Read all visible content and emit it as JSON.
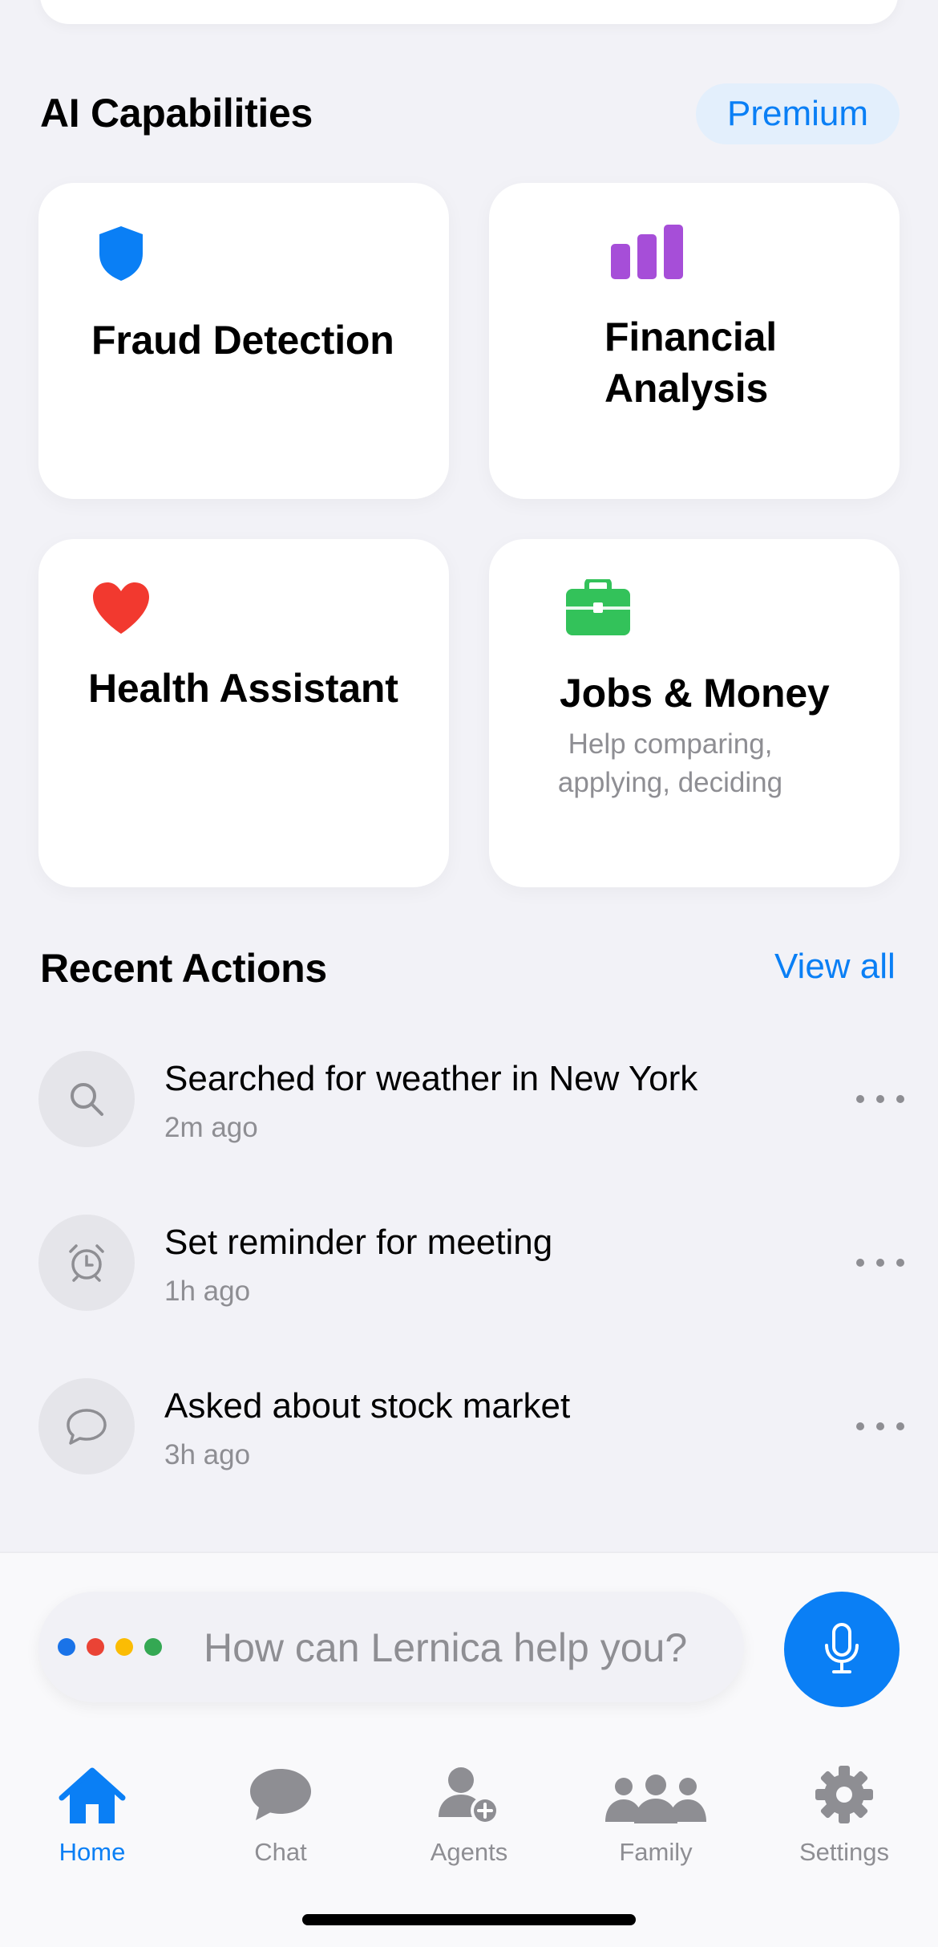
{
  "capabilities": {
    "heading": "AI Capabilities",
    "badge": "Premium",
    "cards": [
      {
        "title": "Fraud Detection",
        "icon": "shield-icon",
        "color": "#0a7ff5"
      },
      {
        "title_line1": "Financial",
        "title_line2": "Analysis",
        "icon": "bar-chart-icon",
        "color": "#a64ed8"
      },
      {
        "title": "Health Assistant",
        "icon": "heart-icon",
        "color": "#f2392f"
      },
      {
        "title": "Jobs & Money",
        "desc_line1": "Help comparing,",
        "desc_line2": "applying, deciding",
        "icon": "briefcase-icon",
        "color": "#33c25a"
      }
    ]
  },
  "recent": {
    "heading": "Recent Actions",
    "view_all": "View all",
    "items": [
      {
        "title": "Searched for weather in New York",
        "time": "2m ago",
        "icon": "search-icon"
      },
      {
        "title": "Set reminder for meeting",
        "time": "1h ago",
        "icon": "alarm-clock-icon"
      },
      {
        "title": "Asked about stock market",
        "time": "3h ago",
        "icon": "chat-bubble-icon"
      }
    ]
  },
  "assistant": {
    "placeholder": "How can Lernica help you?",
    "dot_colors": [
      "#1a73e8",
      "#ea4335",
      "#fbbc04",
      "#34a853"
    ]
  },
  "tabs": [
    {
      "label": "Home",
      "icon": "home-icon",
      "active": true
    },
    {
      "label": "Chat",
      "icon": "chat-icon",
      "active": false
    },
    {
      "label": "Agents",
      "icon": "agent-add-icon",
      "active": false
    },
    {
      "label": "Family",
      "icon": "family-icon",
      "active": false
    },
    {
      "label": "Settings",
      "icon": "gear-icon",
      "active": false
    }
  ],
  "colors": {
    "accent": "#0a7ff5",
    "muted": "#8e8e93",
    "background": "#f2f2f7",
    "card": "#ffffff"
  }
}
